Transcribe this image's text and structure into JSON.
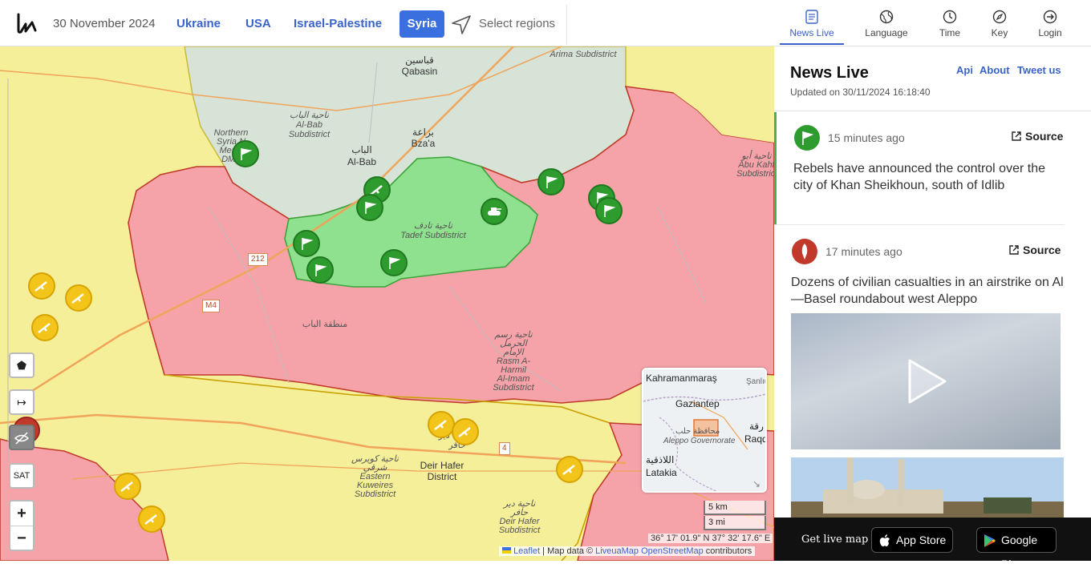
{
  "header": {
    "date": "30 November 2024",
    "regions": [
      "Ukraine",
      "USA",
      "Israel-Palestine"
    ],
    "active_region": "Syria",
    "select_regions": "Select regions"
  },
  "nav": {
    "news_live": "News Live",
    "language": "Language",
    "time": "Time",
    "key": "Key",
    "login": "Login"
  },
  "map": {
    "towns": {
      "qabasin_ar": "قباسين",
      "qabasin": "Qabasin",
      "al_bab_ar": "الباب",
      "al_bab": "Al-Bab",
      "bzaa_ar": "بزاعة",
      "bzaa": "Bza'a",
      "deir_hafer": "Deir Hafer\nDistrict"
    },
    "labels": {
      "arima": "Arima Subdistrict",
      "northern_syria": "Northern\nSyria N\nMen's\nDMZ",
      "al_bab_subdistrict": "ناحية الباب\nAl-Bab\nSubdistrict",
      "tadef": "ناحية تادف\nTadef Subdistrict",
      "rasm": "ناحية رسم\nالحرمل\nالإمام\nRasm A-\nHarmil\nAl-Imam\nSubdistrict",
      "eastern_kuweires": "ناحية كويرس\nشرقي\nEastern\nKuweires\nSubdistrict",
      "deir_hafer_sub": "ناحية دير\nحافر\nDeir Hafer\nSubdistrict",
      "deir_hafer_ar": "منطقة دير\nحافر",
      "al_bab_region": "منطقة الباب",
      "abu_kahf": "ناحية أبو\nAbu Kahf\nSubdistrict"
    },
    "roads": [
      "212",
      "M4",
      "4"
    ],
    "controls": {
      "polygon": "⬟",
      "arrow": "↦",
      "sat": "SAT",
      "zoom_in": "+",
      "zoom_out": "−"
    },
    "minimap": {
      "kahramanmaras": "Kahramanmaraş",
      "gaziantep": "Gaziantep",
      "aleppo_ar": "محافظة حلب",
      "aleppo": "Aleppo Governorate",
      "latakia_ar": "اللاذقية",
      "latakia": "Latakia",
      "sanliurfa": "Şanlıur",
      "raqqa_ar": "رقة",
      "raqqa": "Raqq"
    },
    "scale_km": "5 km",
    "scale_mi": "3 mi",
    "coords": "36° 17' 01.9\" N 37° 32' 17.6\" E",
    "attribution": {
      "leaflet": "Leaflet",
      "map_data": "| Map data ©",
      "liveuamap": "LiveuaMap",
      "osm": "OpenStreetMap",
      "contributors": "contributors"
    },
    "colors": {
      "rebels_green": "#8fe08f",
      "regime_red": "#f5a3a8",
      "sdf_yellow": "#f5ef9a",
      "turkey_gray": "#d7e3d7"
    }
  },
  "panel": {
    "title": "News Live",
    "updated": "Updated on 30/11/2024 16:18:40",
    "links": [
      "Api",
      "About",
      "Tweet us"
    ],
    "items": [
      {
        "time": "15 minutes ago",
        "source": "Source",
        "text": "Rebels have announced the control over the city of Khan Sheikhoun, south of Idlib",
        "icon": "green-flag-icon"
      },
      {
        "time": "17 minutes ago",
        "source": "Source",
        "text": "Dozens of civilian casualties in an airstrike on Al—Basel roundabout west Aleppo",
        "icon": "airstrike-icon"
      }
    ]
  },
  "appbar": {
    "get_live_map": "Get live map",
    "app_store": "App Store",
    "google_play": "Google Play"
  }
}
